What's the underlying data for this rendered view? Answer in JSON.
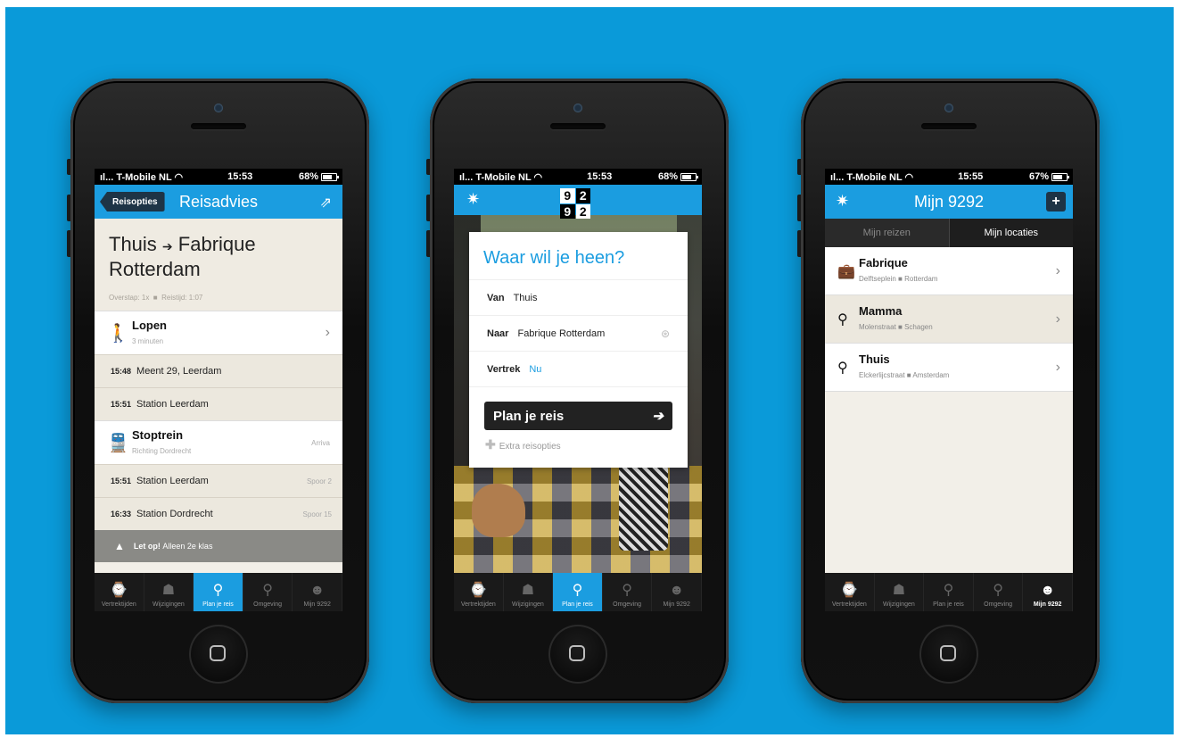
{
  "colors": {
    "background": "#0a9ad9",
    "accent": "#1b9de0",
    "dark": "#1e3446"
  },
  "screen1": {
    "status": {
      "carrier": "T-Mobile NL",
      "time": "15:53",
      "battery": "68%"
    },
    "nav": {
      "back": "Reisopties",
      "title": "Reisadvies",
      "action_icon": "share-icon"
    },
    "route": {
      "from": "Thuis",
      "arrow": "➔",
      "to": "Fabrique Rotterdam",
      "overstap": "Overstap: 1x",
      "reistijd": "Reistijd: 1:07"
    },
    "leg1": {
      "title": "Lopen",
      "sub": "3 minuten",
      "icon": "walk-icon"
    },
    "stops1": [
      {
        "time": "15:48",
        "place": "Meent 29, Leerdam",
        "platform": ""
      },
      {
        "time": "15:51",
        "place": "Station Leerdam",
        "platform": ""
      }
    ],
    "leg2": {
      "title": "Stoptrein",
      "sub": "Richting Dordrecht",
      "operator": "Arriva",
      "icon": "train-icon"
    },
    "stops2": [
      {
        "time": "15:51",
        "place": "Station Leerdam",
        "platform": "Spoor 2"
      },
      {
        "time": "16:33",
        "place": "Station Dordrecht",
        "platform": "Spoor 15"
      }
    ],
    "warning": {
      "bold": "Let op!",
      "text": "Alleen 2e klas"
    }
  },
  "screen2": {
    "status": {
      "carrier": "T-Mobile NL",
      "time": "15:53",
      "battery": "68%"
    },
    "logo": [
      "9",
      "2",
      "9",
      "2"
    ],
    "title": "Waar wil je heen?",
    "van": {
      "label": "Van",
      "value": "Thuis"
    },
    "naar": {
      "label": "Naar",
      "value": "Fabrique Rotterdam"
    },
    "vertrek": {
      "label": "Vertrek",
      "value": "Nu"
    },
    "plan_button": "Plan je reis",
    "extra": "Extra reisopties"
  },
  "screen3": {
    "status": {
      "carrier": "T-Mobile NL",
      "time": "15:55",
      "battery": "67%"
    },
    "title": "Mijn 9292",
    "tabs": [
      "Mijn reizen",
      "Mijn locaties"
    ],
    "locations": [
      {
        "name": "Fabrique",
        "street": "Delftseplein",
        "city": "Rotterdam",
        "icon": "briefcase-icon"
      },
      {
        "name": "Mamma",
        "street": "Molenstraat",
        "city": "Schagen",
        "icon": "pin-icon"
      },
      {
        "name": "Thuis",
        "street": "Elckerlijcstraat",
        "city": "Amsterdam",
        "icon": "pin-icon"
      }
    ]
  },
  "tabbar": [
    "Vertrektijden",
    "Wijzigingen",
    "Plan je reis",
    "Omgeving",
    "Mijn 9292"
  ]
}
